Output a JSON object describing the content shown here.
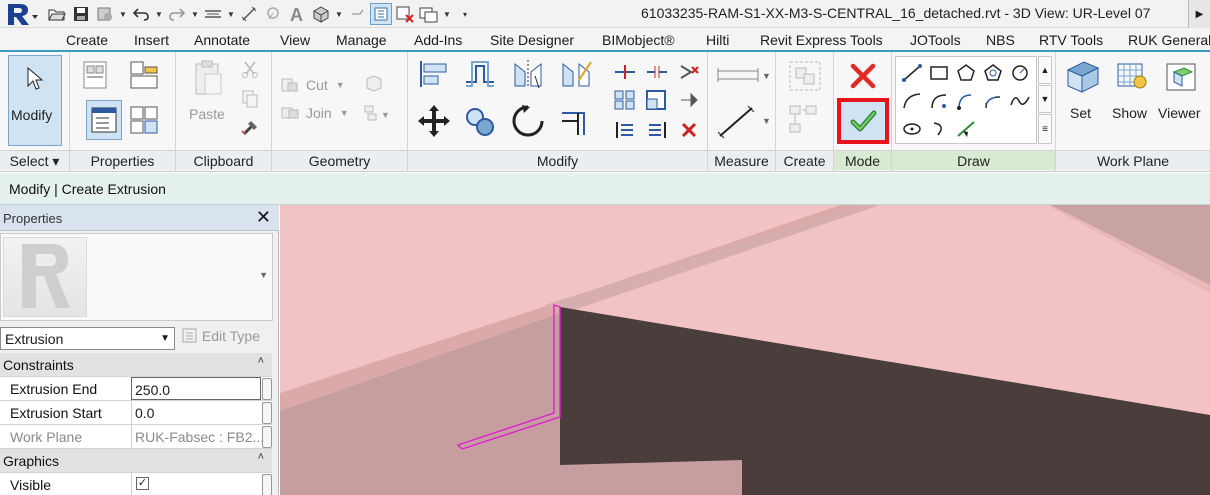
{
  "window": {
    "title": "61033235-RAM-S1-XX-M3-S-CENTRAL_16_detached.rvt - 3D View: UR-Level 07"
  },
  "quick_access": [
    "open-icon",
    "save-icon",
    "sync-icon",
    "undo-icon",
    "redo-icon",
    "measure-icon",
    "dimension-icon",
    "tag-icon",
    "text-icon",
    "3d-view-icon",
    "section-icon",
    "thin-lines-icon",
    "close-hidden-icon",
    "switch-windows-icon"
  ],
  "tabs": [
    "Create",
    "Insert",
    "Annotate",
    "View",
    "Manage",
    "Add-Ins",
    "Site Designer",
    "BIMobject®",
    "Hilti",
    "Revit Express Tools",
    "JOTools",
    "NBS",
    "RTV Tools",
    "RUK General"
  ],
  "ribbon": {
    "select": {
      "label": "Select",
      "modify_label": "Modify"
    },
    "properties": {
      "label": "Properties"
    },
    "clipboard": {
      "label": "Clipboard",
      "paste_label": "Paste"
    },
    "geometry": {
      "label": "Geometry",
      "cut_label": "Cut",
      "join_label": "Join"
    },
    "modify": {
      "label": "Modify"
    },
    "measure": {
      "label": "Measure"
    },
    "create": {
      "label": "Create"
    },
    "mode": {
      "label": "Mode",
      "highlight_color": "#e8141c"
    },
    "draw": {
      "label": "Draw"
    },
    "work_plane": {
      "label": "Work Plane",
      "set_label": "Set",
      "show_label": "Show",
      "viewer_label": "Viewer"
    }
  },
  "context_bar": {
    "text": "Modify | Create Extrusion"
  },
  "properties_palette": {
    "title": "Properties",
    "family": "Extrusion",
    "edit_type_label": "Edit Type",
    "groups": [
      {
        "name": "Constraints",
        "rows": [
          {
            "key": "Extrusion End",
            "value": "250.0"
          },
          {
            "key": "Extrusion Start",
            "value": "0.0"
          },
          {
            "key": "Work Plane",
            "value": "RUK-Fabsec : FB2..."
          }
        ]
      },
      {
        "name": "Graphics",
        "rows": [
          {
            "key": "Visible",
            "checked": true
          }
        ]
      }
    ]
  },
  "colors": {
    "sketch_line": "#e020d0",
    "slab_top": "#f1c3c4",
    "beam_web": "#4b3d3c",
    "accent_blue": "#3a9abf"
  }
}
